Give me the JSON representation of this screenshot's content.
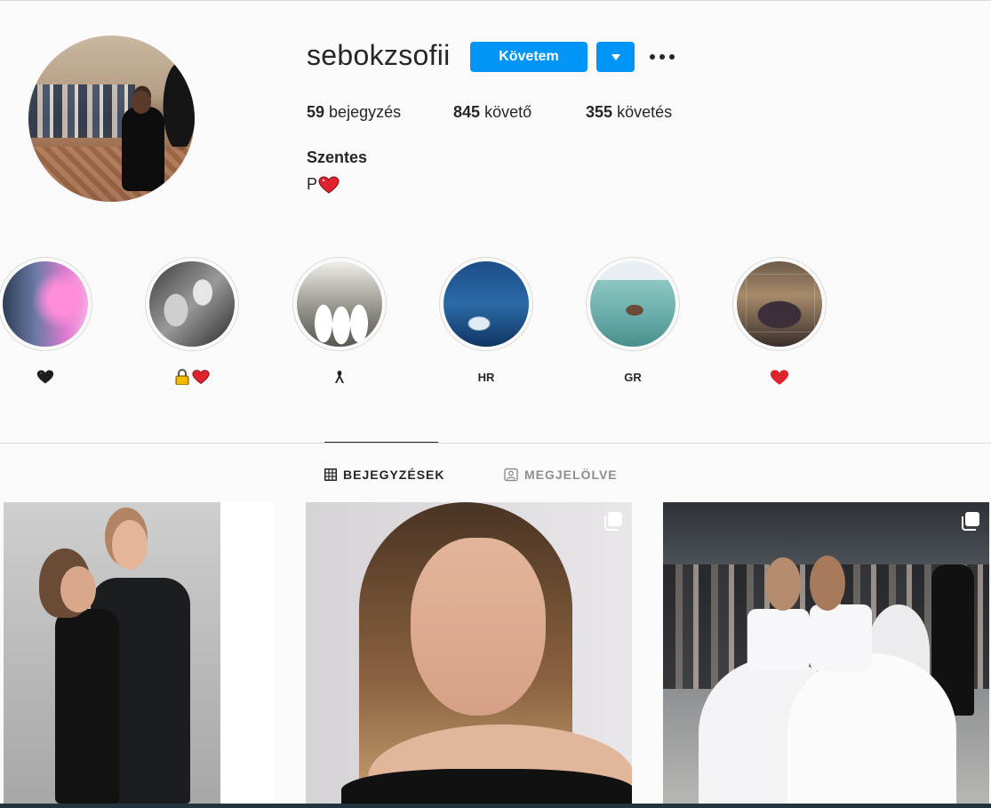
{
  "profile": {
    "username": "sebokzsofii",
    "follow_label": "Követem",
    "stats": {
      "posts_count": "59",
      "posts_label": "bejegyzés",
      "followers_count": "845",
      "followers_label": "követő",
      "following_count": "355",
      "following_label": "követés"
    },
    "full_name": "Szentes",
    "bio_text": "P"
  },
  "highlights": [
    {
      "label": "",
      "icon": "black-heart-emoji"
    },
    {
      "label": "",
      "icon": "lock-and-heart-emoji"
    },
    {
      "label": "",
      "icon": "ribbon-emoji"
    },
    {
      "label": "HR"
    },
    {
      "label": "GR"
    },
    {
      "label": "",
      "icon": "red-heart-emoji"
    }
  ],
  "tabs": [
    {
      "label": "BEJEGYZÉSEK",
      "icon": "grid-icon",
      "active": true
    },
    {
      "label": "MEGJELÖLVE",
      "icon": "tagged-user-icon",
      "active": false
    }
  ],
  "posts": [
    {
      "kind": "single"
    },
    {
      "kind": "carousel",
      "icon": "multiple-images-icon"
    },
    {
      "kind": "carousel",
      "icon": "multiple-images-icon"
    }
  ],
  "colors": {
    "accent": "#0095f6",
    "heart_red": "#e0222c",
    "text": "#262626",
    "muted": "#8e8e8e"
  }
}
